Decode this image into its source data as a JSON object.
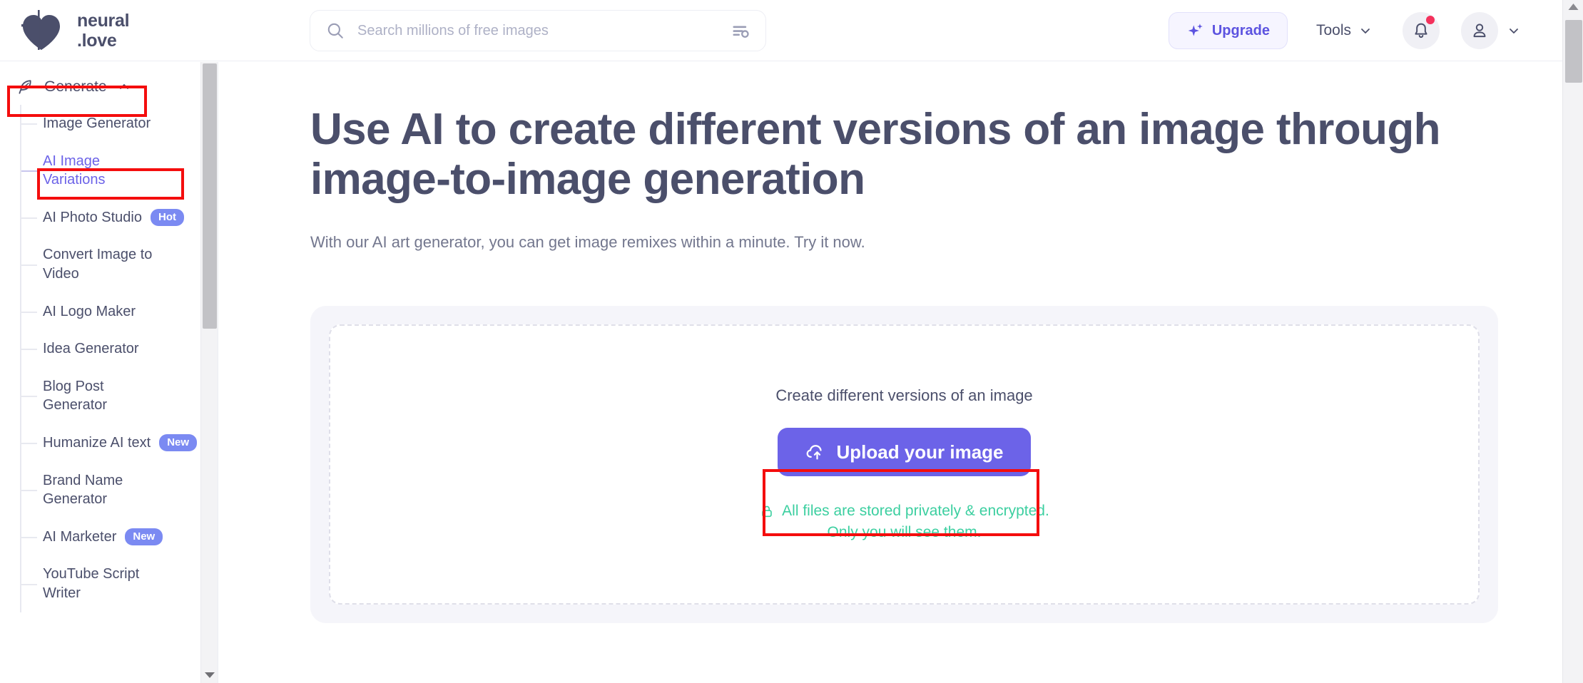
{
  "header": {
    "logo": {
      "icon": "heart-pixel-logo",
      "line1": "neural",
      "line2": ".love"
    },
    "search": {
      "icon": "search-icon",
      "value": "",
      "placeholder": "Search millions of free images",
      "filter_icon": "filter-settings-icon"
    },
    "upgrade": {
      "icon": "sparkle-icon",
      "label": "Upgrade"
    },
    "tools": {
      "label": "Tools",
      "chevron": "chevron-down-icon"
    },
    "notifications": {
      "icon": "bell-icon",
      "has_unread": true,
      "dot_color": "#f4315c"
    },
    "account": {
      "icon": "user-icon",
      "chevron": "chevron-down-icon"
    }
  },
  "sidebar": {
    "section": {
      "icon": "feather-pen-icon",
      "label": "Generate",
      "chevron": "chevron-up-icon",
      "expanded": true
    },
    "items": [
      {
        "label": "Image Generator",
        "badge": null,
        "active": false
      },
      {
        "label": "AI Image Variations",
        "badge": null,
        "active": true
      },
      {
        "label": "AI Photo Studio",
        "badge": "Hot",
        "active": false
      },
      {
        "label": "Convert Image to Video",
        "badge": null,
        "active": false
      },
      {
        "label": "AI Logo Maker",
        "badge": null,
        "active": false
      },
      {
        "label": "Idea Generator",
        "badge": null,
        "active": false
      },
      {
        "label": "Blog Post Generator",
        "badge": null,
        "active": false
      },
      {
        "label": "Humanize AI text",
        "badge": "New",
        "active": false
      },
      {
        "label": "Brand Name Generator",
        "badge": null,
        "active": false
      },
      {
        "label": "AI Marketer",
        "badge": "New",
        "active": false
      },
      {
        "label": "YouTube Script Writer",
        "badge": null,
        "active": false
      }
    ]
  },
  "main": {
    "heading": "Use AI to create different versions of an image through image-to-image generation",
    "subheading": "With our AI art generator, you can get image remixes within a minute. Try it now.",
    "upload": {
      "dropzone_title": "Create different versions of an image",
      "button": {
        "icon": "cloud-upload-icon",
        "label": "Upload your image"
      },
      "privacy_icon": "lock-icon",
      "privacy_line1": "All files are stored privately & encrypted.",
      "privacy_line2": "Only you will see them."
    }
  },
  "colors": {
    "accent_purple": "#6c63e8",
    "badge_blue": "#7b8af2",
    "privacy_green": "#3ccfa0",
    "heading_navy": "#4b4f6b",
    "annotation_red": "#f40d0d"
  }
}
